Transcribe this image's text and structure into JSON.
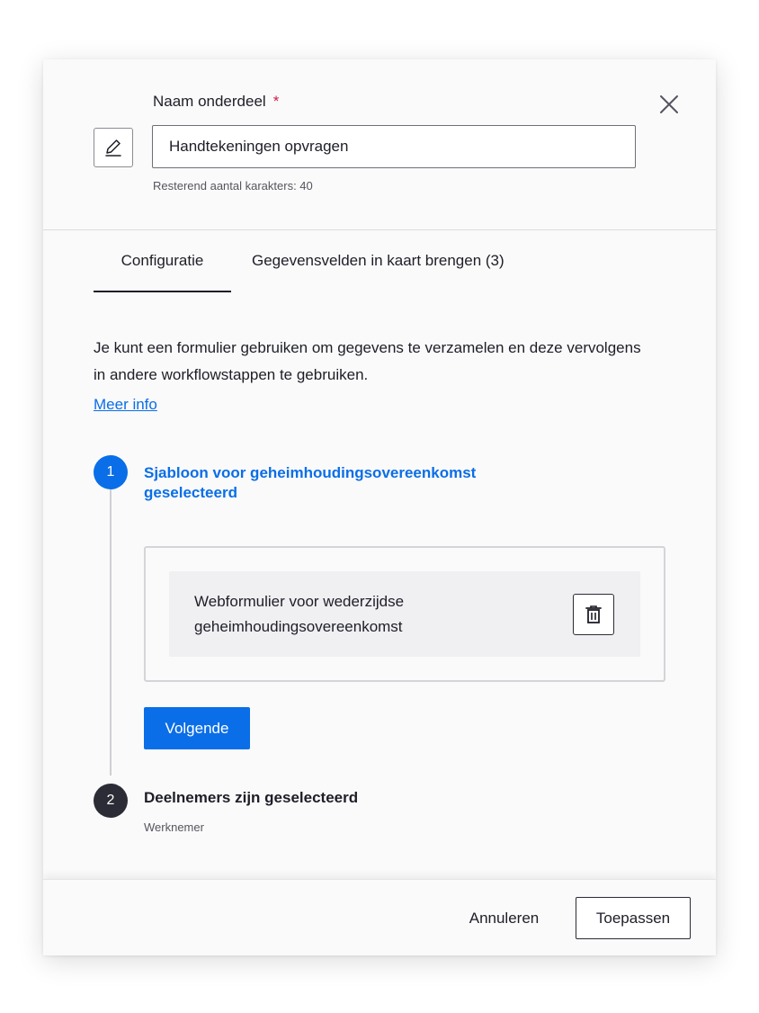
{
  "header": {
    "name_label": "Naam onderdeel",
    "required_mark": "*",
    "name_value": "Handtekeningen opvragen",
    "remaining_chars": "Resterend aantal karakters: 40",
    "edit_icon": "pencil-icon",
    "close_icon": "close-icon"
  },
  "tabs": [
    {
      "label": "Configuratie",
      "active": true
    },
    {
      "label": "Gegevensvelden in kaart brengen (3)",
      "active": false
    }
  ],
  "intro": {
    "text": "Je kunt een formulier gebruiken om gegevens te verzamelen en deze vervolgens in andere workflowstappen te gebruiken.",
    "link": "Meer info"
  },
  "steps": [
    {
      "number": "1",
      "title": "Sjabloon voor geheimhoudingsovereenkomst geselecteerd",
      "form_item": "Webformulier voor wederzijdse geheimhoudingsovereenkomst",
      "delete_icon": "trash-icon",
      "next_label": "Volgende"
    },
    {
      "number": "2",
      "title": "Deelnemers zijn geselecteerd",
      "subtitle": "Werknemer"
    }
  ],
  "footer": {
    "cancel_label": "Annuleren",
    "apply_label": "Toepassen"
  },
  "colors": {
    "accent": "#0a6ee8",
    "required": "#d11c4d",
    "dark": "#2b2c36"
  }
}
